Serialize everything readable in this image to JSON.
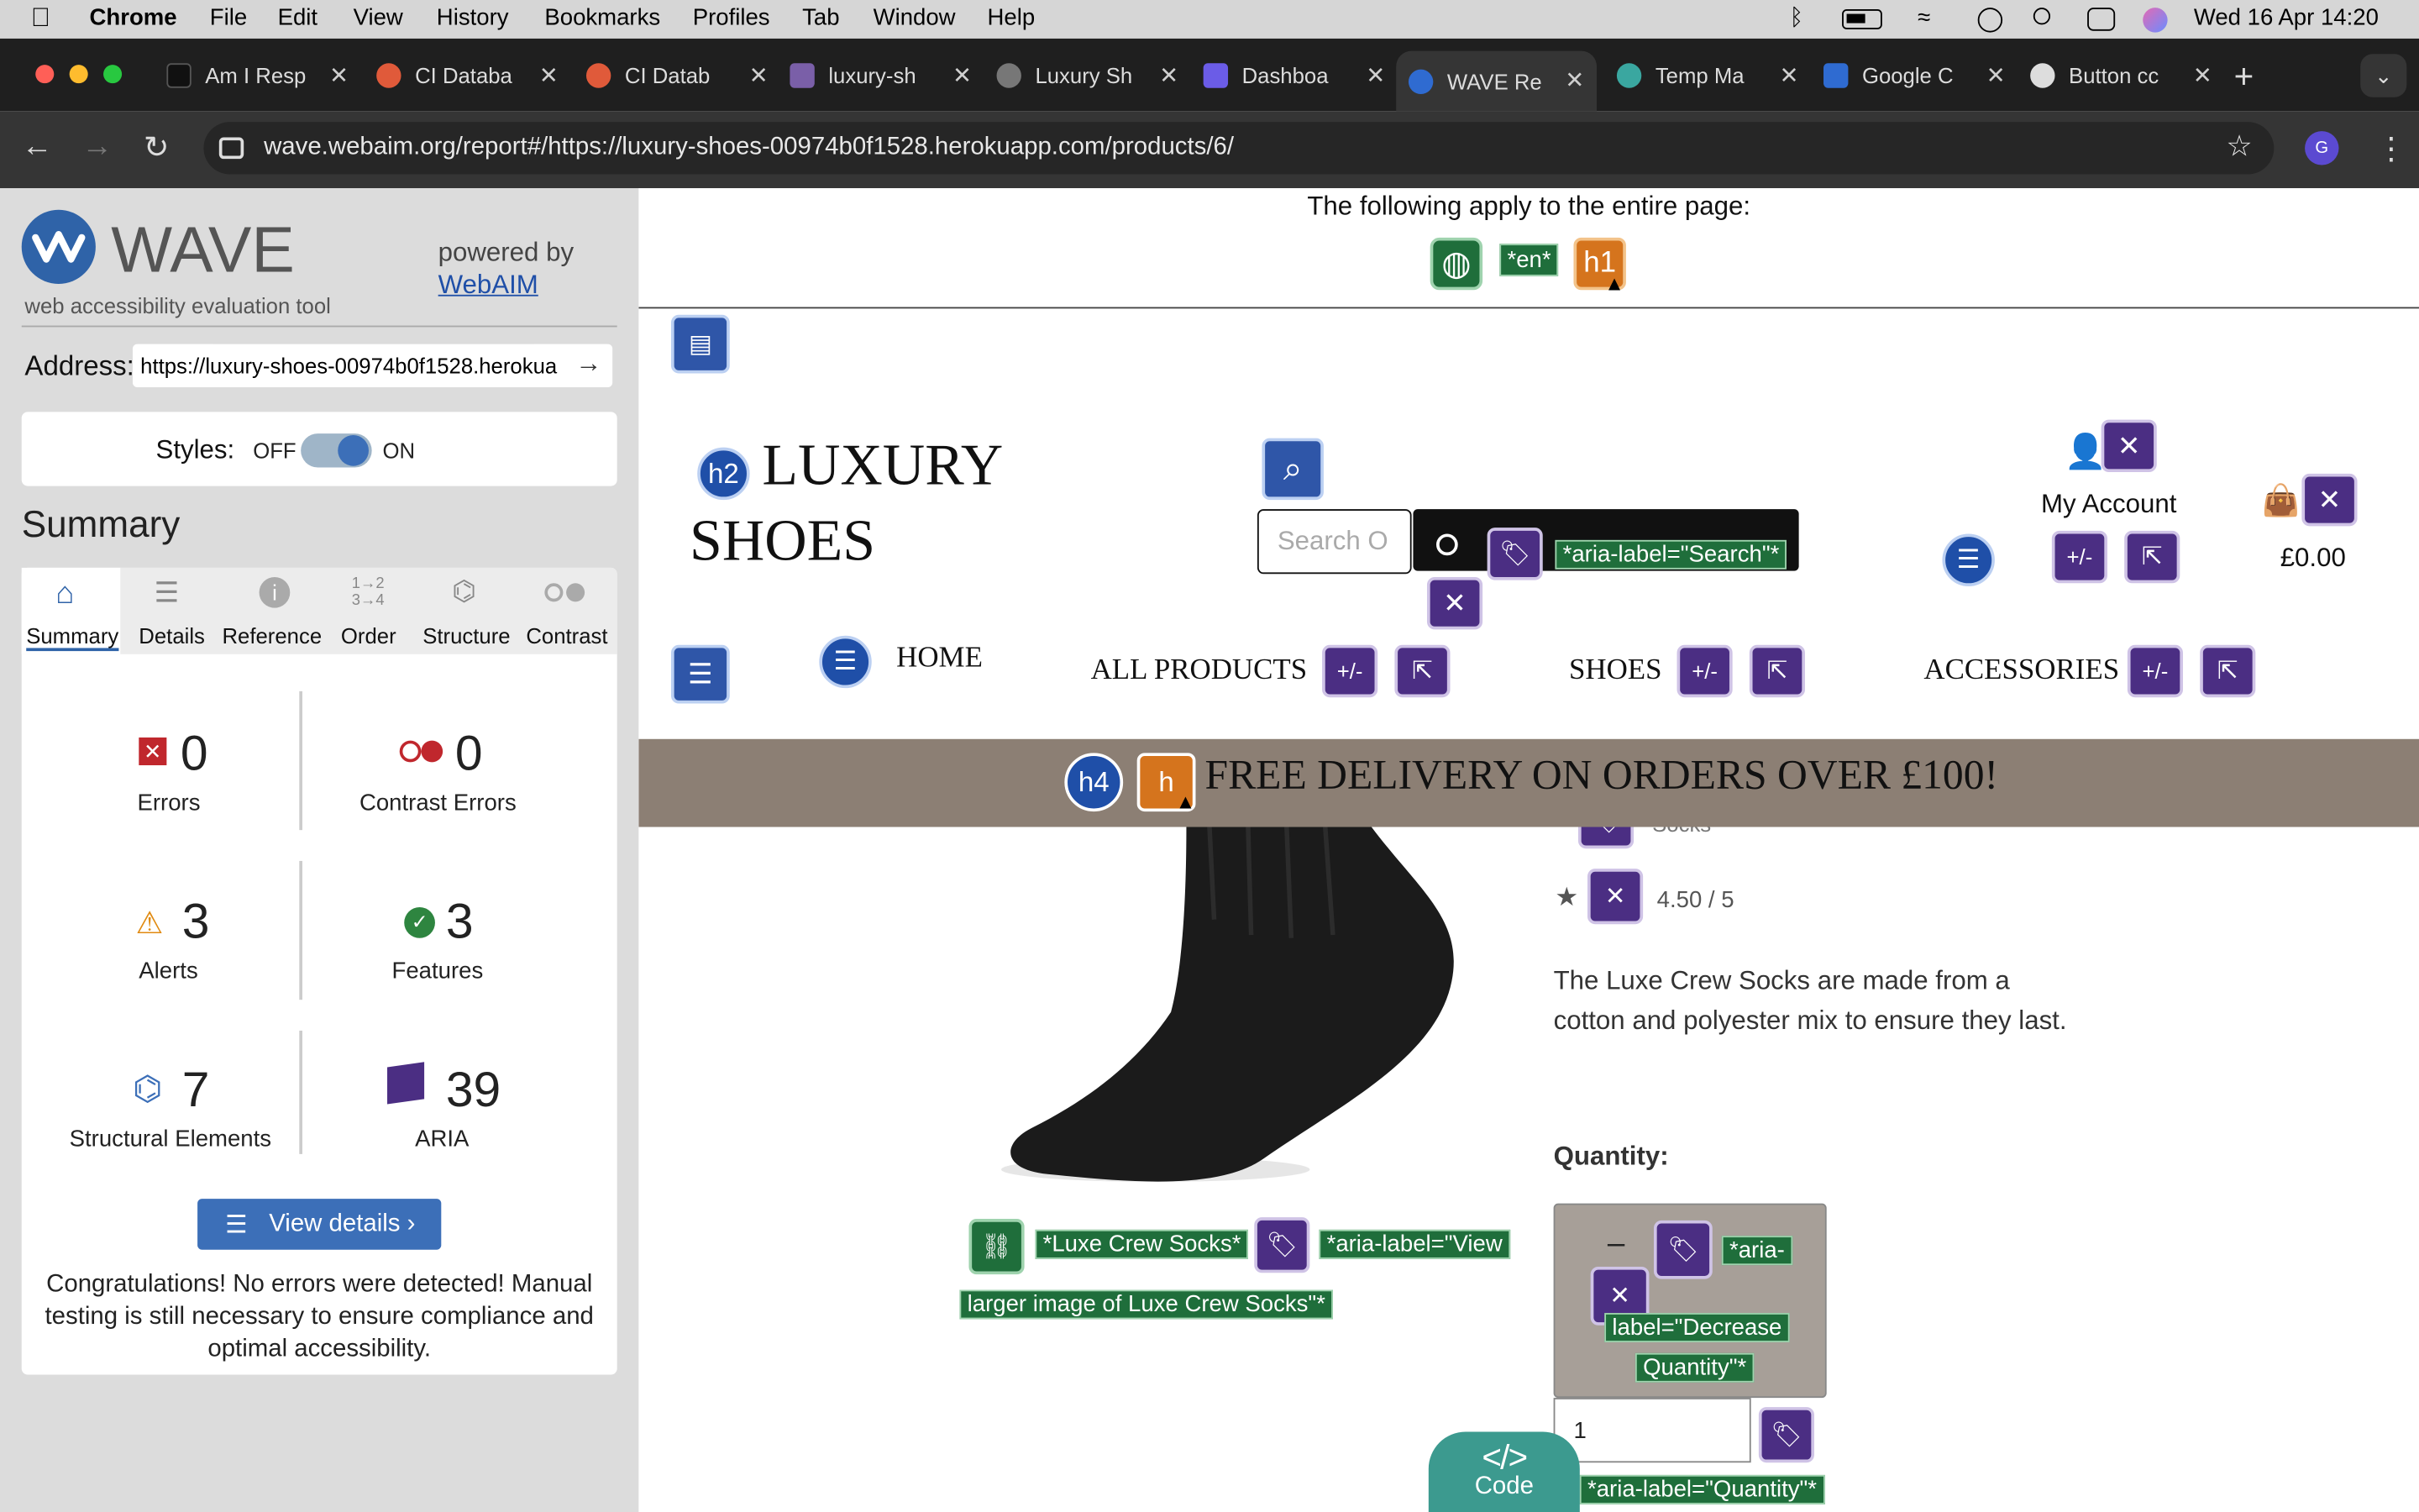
{
  "menubar": {
    "app": "Chrome",
    "items": [
      "File",
      "Edit",
      "View",
      "History",
      "Bookmarks",
      "Profiles",
      "Tab",
      "Window",
      "Help"
    ],
    "clock": "Wed 16 Apr  14:20"
  },
  "tabs": [
    {
      "title": "Am I Resp",
      "color": "#111111"
    },
    {
      "title": "CI Databa",
      "color": "#e05a3a"
    },
    {
      "title": "CI Datab",
      "color": "#e05a3a"
    },
    {
      "title": "luxury-sh",
      "color": "#7a5fa8"
    },
    {
      "title": "Luxury Sh",
      "color": "#777777"
    },
    {
      "title": "Dashboa",
      "color": "#6b5ce7"
    },
    {
      "title": "WAVE Re",
      "color": "#2f6bd1"
    },
    {
      "title": "Temp Ma",
      "color": "#3aa7a0"
    },
    {
      "title": "Google C",
      "color": "#2f6bd1"
    },
    {
      "title": "Button cc",
      "color": "#dddddd"
    }
  ],
  "omnibox": {
    "url": "wave.webaim.org/report#/https://luxury-shoes-00974b0f1528.herokuapp.com/products/6/"
  },
  "profile_initial": "G",
  "wave": {
    "title": "WAVE",
    "subtitle": "web accessibility evaluation tool",
    "powered_by": "powered by",
    "webaim": "WebAIM",
    "address_label": "Address:",
    "address_value": "https://luxury-shoes-00974b0f1528.herokua",
    "styles_label": "Styles:",
    "off": "OFF",
    "on": "ON",
    "summary_heading": "Summary",
    "tabs": [
      "Summary",
      "Details",
      "Reference",
      "Order",
      "Structure",
      "Contrast"
    ],
    "stats": {
      "errors": {
        "value": "0",
        "label": "Errors"
      },
      "contrast": {
        "value": "0",
        "label": "Contrast Errors"
      },
      "alerts": {
        "value": "3",
        "label": "Alerts"
      },
      "features": {
        "value": "3",
        "label": "Features"
      },
      "structural": {
        "value": "7",
        "label": "Structural Elements"
      },
      "aria": {
        "value": "39",
        "label": "ARIA"
      }
    },
    "view_details": "View details ›",
    "congrats": "Congratulations! No errors were detected! Manual testing is still necessary to ensure compliance and optimal accessibility."
  },
  "page": {
    "entire_page_text": "The following apply to the entire page:",
    "lang_badge": "*en*",
    "h1_badge": "h1",
    "h2_badge": "h2",
    "h4_badge": "h4",
    "brand_line1": "LUXURY",
    "brand_line2": "SHOES",
    "search_placeholder": "Search O",
    "search_aria": "*aria-label=\"Search\"*",
    "my_account": "My Account",
    "cart_total": "£0.00",
    "nav": [
      "HOME",
      "ALL PRODUCTS",
      "SHOES",
      "ACCESSORIES"
    ],
    "banner": "FREE DELIVERY ON ORDERS OVER £100!",
    "category_partial": "Socks",
    "rating": "4.50 / 5",
    "description": "The Luxe Crew Socks are made from a cotton and polyester mix to ensure they last.",
    "alt_label": "*Luxe Crew Socks*",
    "view_larger_part1": "*aria-label=\"View",
    "view_larger_part2": "larger image of Luxe Crew Socks\"*",
    "quantity_label": "Quantity:",
    "decrease_minus": "–",
    "decrease_aria_1": "*aria-",
    "decrease_aria_2": "label=\"Decrease",
    "decrease_aria_3": "Quantity\"*",
    "quantity_value": "1",
    "quantity_aria": "*aria-label=\"Quantity\"*",
    "code_button": "Code",
    "plus_minus": "+/-"
  }
}
